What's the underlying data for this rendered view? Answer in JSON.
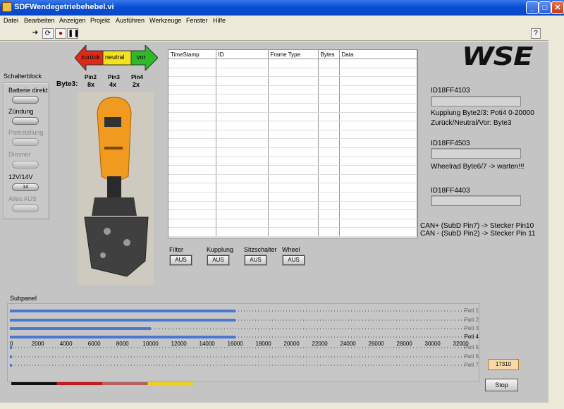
{
  "window": {
    "title": "SDFWendegetriebehebel.vi"
  },
  "menu": [
    "Datei",
    "Bearbeiten",
    "Anzeigen",
    "Projekt",
    "Ausführen",
    "Werkzeuge",
    "Fenster",
    "Hilfe"
  ],
  "schalterblock": {
    "title": "Schalterblock",
    "items": [
      {
        "label": "Batterie direkt",
        "value": "",
        "enabled": true
      },
      {
        "label": "Zündung",
        "value": "",
        "enabled": true
      },
      {
        "label": "Parkstellung",
        "value": "",
        "enabled": false
      },
      {
        "label": "Dimmer",
        "value": "",
        "enabled": false
      },
      {
        "label": "12V/14V",
        "value": "14",
        "enabled": true
      },
      {
        "label": "Alles AUS",
        "value": "",
        "enabled": false
      }
    ]
  },
  "direction": {
    "zurueck": "zurück",
    "neutral": "neutral",
    "vor": "vor"
  },
  "byte3": {
    "label": "Byte3:",
    "pins": [
      {
        "pin": "Pin2",
        "mult": "8x"
      },
      {
        "pin": "Pin3",
        "mult": "4x"
      },
      {
        "pin": "Pin4",
        "mult": "2x"
      }
    ]
  },
  "grid": {
    "columns": [
      "TimeStamp",
      "ID",
      "Frame Type",
      "Bytes",
      "Data"
    ],
    "rows": 20
  },
  "filters": [
    {
      "label": "Filter",
      "button": "AUS"
    },
    {
      "label": "Kupplung",
      "button": "AUS"
    },
    {
      "label": "Sitzschalter",
      "button": "AUS"
    },
    {
      "label": "Wheel",
      "button": "AUS"
    }
  ],
  "logo": "WSE",
  "ids": [
    {
      "id": "ID18FF4103",
      "notes": [
        "Kupplung Byte2/3: Poti4 0-20000",
        "Zurück/Neutral/Vor: Byte3"
      ]
    },
    {
      "id": "ID18FF4503",
      "notes": [
        "Wheelrad Byte6/7 -> warten!!!"
      ]
    },
    {
      "id": "ID18FF4403",
      "notes": []
    }
  ],
  "can_notes": [
    "CAN+ (SubD Pin7) -> Stecker Pin10",
    "CAN - (SubD Pin2) -> Stecker Pin 11"
  ],
  "subpanel": {
    "title": "Subpanel",
    "scale": [
      "0",
      "2000",
      "4000",
      "6000",
      "8000",
      "10000",
      "12000",
      "14000",
      "16000",
      "18000",
      "20000",
      "22000",
      "24000",
      "26000",
      "28000",
      "30000",
      "32000"
    ],
    "sliders": [
      {
        "name": "Poti 1",
        "value": 16000
      },
      {
        "name": "Poti 2",
        "value": 16000
      },
      {
        "name": "Poti 3",
        "value": 10000
      },
      {
        "name": "Poti 4",
        "value": 16000
      },
      {
        "name": "Poti 5",
        "value": 0
      },
      {
        "name": "Poti 6",
        "value": 0
      },
      {
        "name": "Poti 7",
        "value": 0
      }
    ],
    "max": 32000
  },
  "value_display": "17310",
  "stop_label": "Stop"
}
